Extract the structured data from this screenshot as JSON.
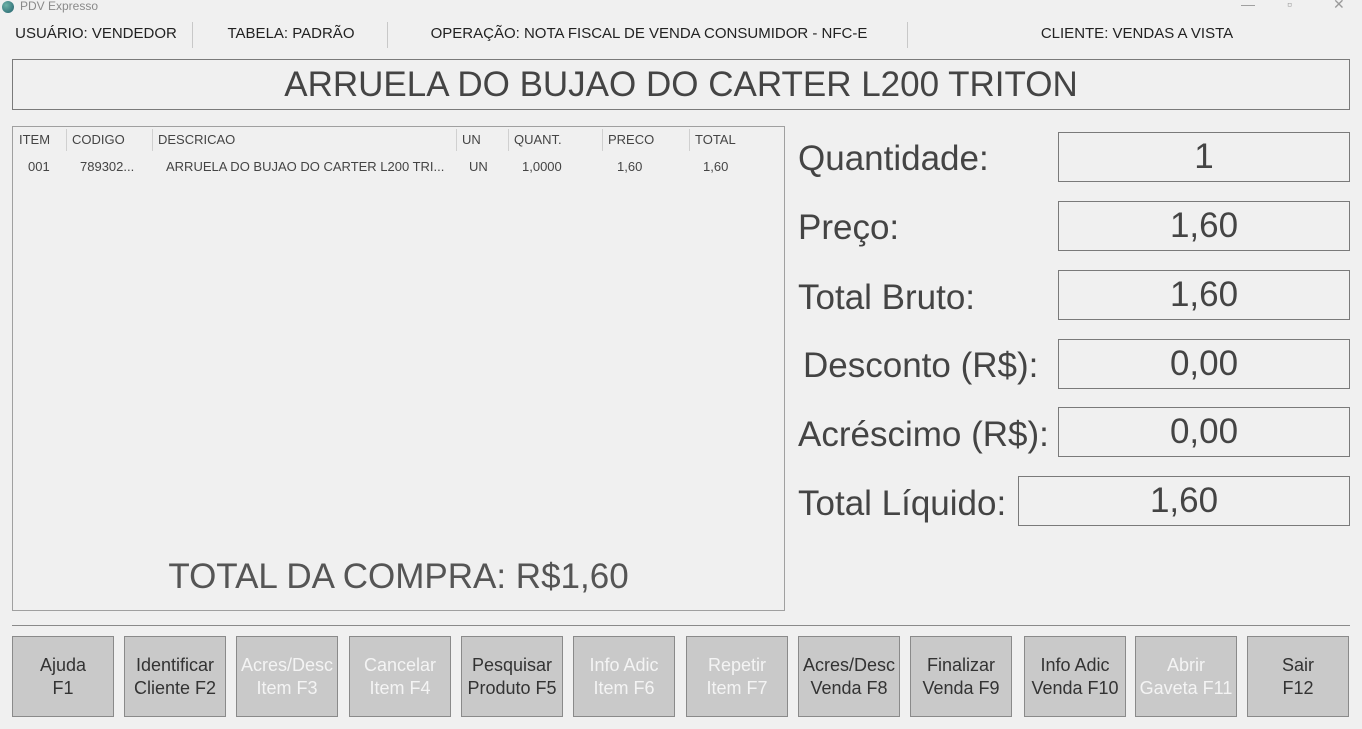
{
  "window": {
    "title": "PDV Expresso",
    "minimize": "—",
    "maximize": "▫",
    "close": "✕"
  },
  "info_bar": {
    "usuario": "USUÁRIO: VENDEDOR",
    "tabela": "TABELA: PADRÃO",
    "operacao": "OPERAÇÃO: NOTA FISCAL DE VENDA CONSUMIDOR - NFC-E",
    "cliente": "CLIENTE: VENDAS A VISTA"
  },
  "product_name": "ARRUELA DO BUJAO DO CARTER L200 TRITON",
  "items_table": {
    "headers": [
      "ITEM",
      "CODIGO",
      "DESCRICAO",
      "UN",
      "QUANT.",
      "PRECO",
      "TOTAL"
    ],
    "rows": [
      [
        "001",
        "789302...",
        "ARRUELA DO BUJAO DO CARTER L200 TRI...",
        "UN",
        "1,0000",
        "1,60",
        "1,60"
      ]
    ]
  },
  "total_compra": "TOTAL DA COMPRA: R$1,60",
  "fields": {
    "quantidade": {
      "label": "Quantidade:",
      "value": "1"
    },
    "preco": {
      "label": "Preço:",
      "value": "1,60"
    },
    "total_bruto": {
      "label": "Total Bruto:",
      "value": "1,60"
    },
    "desconto": {
      "label": "Desconto (R$):",
      "value": "0,00"
    },
    "acrescimo": {
      "label": "Acréscimo (R$):",
      "value": "0,00"
    },
    "total_liquido": {
      "label": "Total Líquido:",
      "value": "1,60"
    }
  },
  "function_keys": [
    {
      "line1": "Ajuda",
      "line2": "F1",
      "enabled": true
    },
    {
      "line1": "Identificar",
      "line2": "Cliente F2",
      "enabled": true
    },
    {
      "line1": "Acres/Desc",
      "line2": "Item F3",
      "enabled": false
    },
    {
      "line1": "Cancelar",
      "line2": "Item F4",
      "enabled": false
    },
    {
      "line1": "Pesquisar",
      "line2": "Produto F5",
      "enabled": true
    },
    {
      "line1": "Info Adic",
      "line2": "Item F6",
      "enabled": false
    },
    {
      "line1": "Repetir",
      "line2": "Item F7",
      "enabled": false
    },
    {
      "line1": "Acres/Desc",
      "line2": "Venda F8",
      "enabled": true
    },
    {
      "line1": "Finalizar",
      "line2": "Venda F9",
      "enabled": true
    },
    {
      "line1": "Info Adic",
      "line2": "Venda F10",
      "enabled": true
    },
    {
      "line1": "Abrir",
      "line2": "Gaveta F11",
      "enabled": false
    },
    {
      "line1": "Sair",
      "line2": "F12",
      "enabled": true
    }
  ]
}
